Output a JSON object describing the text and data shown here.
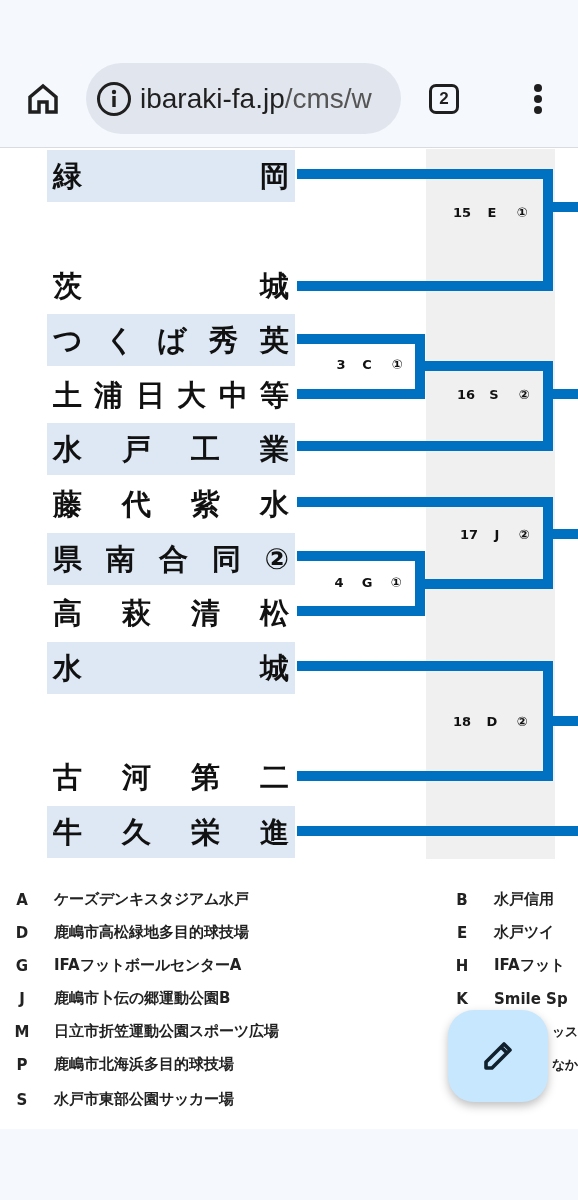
{
  "browser": {
    "url_host": "ibaraki-fa.jp",
    "url_path": "/cms/w",
    "tab_count": "2"
  },
  "teams": [
    {
      "name": "緑岡"
    },
    {
      "name": "茨城"
    },
    {
      "name": "つくば秀英"
    },
    {
      "name": "土浦日大中等"
    },
    {
      "name": "水戸工業"
    },
    {
      "name": "藤代紫水"
    },
    {
      "name": "県南合同②"
    },
    {
      "name": "高萩清松"
    },
    {
      "name": "水城"
    },
    {
      "name": "古河第二"
    },
    {
      "name": "牛久栄進"
    }
  ],
  "matches": [
    {
      "number": "15",
      "venue": "E",
      "mark": "①"
    },
    {
      "number": "3",
      "venue": "C",
      "mark": "①"
    },
    {
      "number": "16",
      "venue": "S",
      "mark": "②"
    },
    {
      "number": "17",
      "venue": "J",
      "mark": "②"
    },
    {
      "number": "4",
      "venue": "G",
      "mark": "①"
    },
    {
      "number": "18",
      "venue": "D",
      "mark": "②"
    }
  ],
  "venues_left": [
    {
      "code": "A",
      "name": "ケーズデンキスタジアム水戸"
    },
    {
      "code": "D",
      "name": "鹿嶋市高松緑地多目的球技場"
    },
    {
      "code": "G",
      "name": "IFAフットボールセンターA"
    },
    {
      "code": "J",
      "name": "鹿嶋市卜伝の郷運動公園B"
    },
    {
      "code": "M",
      "name": "日立市折笠運動公園スポーツ広場"
    },
    {
      "code": "P",
      "name": "鹿嶋市北海浜多目的球技場"
    },
    {
      "code": "S",
      "name": "水戸市東部公園サッカー場"
    }
  ],
  "venues_right": [
    {
      "code": "B",
      "name": "水戸信用"
    },
    {
      "code": "E",
      "name": "水戸ツイ"
    },
    {
      "code": "H",
      "name": "IFAフット"
    },
    {
      "code": "K",
      "name": "Smile Sp"
    },
    {
      "name": "ッス"
    },
    {
      "name": "なか"
    }
  ]
}
